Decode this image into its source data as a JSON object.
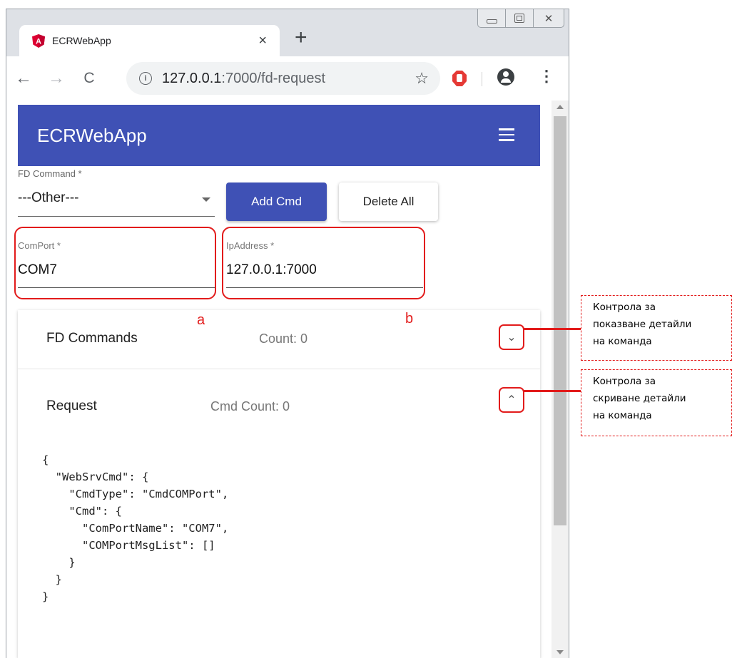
{
  "browser": {
    "tab_title": "ECRWebApp",
    "tab_close": "×",
    "new_tab": "+",
    "nav": {
      "back": "←",
      "forward": "→",
      "reload": "C"
    },
    "url_host": "127.0.0.1",
    "url_rest": ":7000/fd-request",
    "star": "☆",
    "menu": "⋮",
    "window_close": "✕"
  },
  "app": {
    "title": "ECRWebApp",
    "fd_command": {
      "label": "FD Command *",
      "value": "---Other---"
    },
    "buttons": {
      "add": "Add Cmd",
      "delete_all": "Delete All"
    },
    "comport": {
      "label": "ComPort *",
      "value": "COM7"
    },
    "ipaddress": {
      "label": "IpAddress *",
      "value": "127.0.0.1:7000"
    },
    "panels": {
      "commands": {
        "title": "FD Commands",
        "count": "Count: 0"
      },
      "request": {
        "title": "Request",
        "count": "Cmd Count: 0"
      }
    },
    "request_json": "{\n  \"WebSrvCmd\": {\n    \"CmdType\": \"CmdCOMPort\",\n    \"Cmd\": {\n      \"ComPortName\": \"COM7\",\n      \"COMPortMsgList\": []\n    }\n  }\n}"
  },
  "annotations": {
    "marker_a": "a",
    "marker_b": "b",
    "callout_show": [
      "Контрола за",
      "показване детайли",
      "на команда"
    ],
    "callout_hide": [
      "Контрола за",
      "скриване детайли",
      "на команда"
    ],
    "accent_color": "#e21b1b"
  },
  "colors": {
    "primary": "#3f51b5"
  }
}
